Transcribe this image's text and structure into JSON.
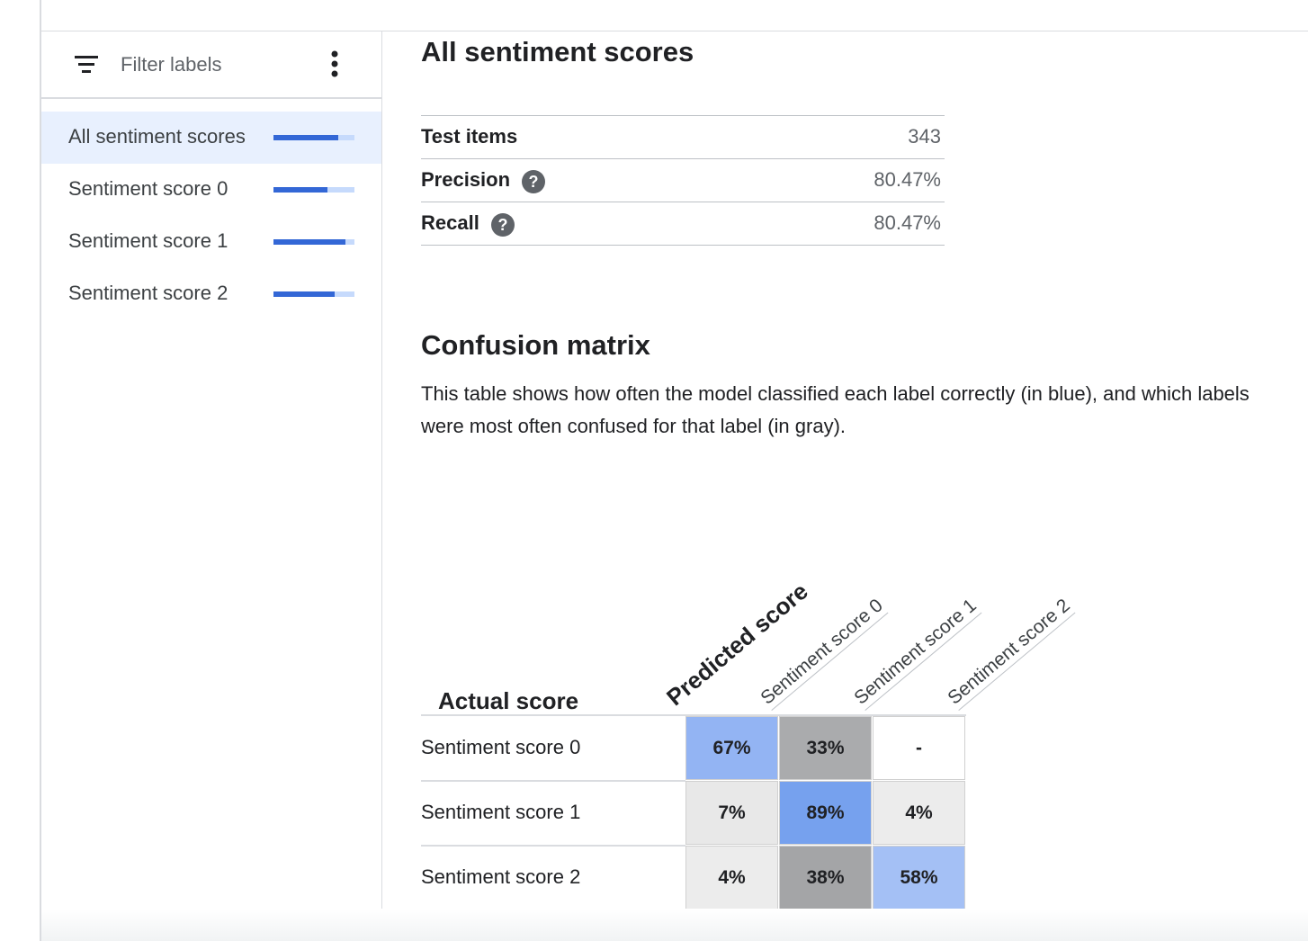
{
  "sidebar": {
    "filter_placeholder": "Filter labels",
    "filter_icon": "filter-list-icon",
    "more_icon": "more-vert-icon",
    "items": [
      {
        "label": "All sentiment scores",
        "score": 0.8047,
        "selected": true
      },
      {
        "label": "Sentiment score 0",
        "score": 0.67,
        "selected": false
      },
      {
        "label": "Sentiment score 1",
        "score": 0.89,
        "selected": false
      },
      {
        "label": "Sentiment score 2",
        "score": 0.75,
        "selected": false
      }
    ],
    "bar_fill_color": "#3367d6",
    "bar_track_color": "#c6dafc"
  },
  "main": {
    "title": "All sentiment scores",
    "stats": [
      {
        "label": "Test items",
        "value": "343",
        "help": false
      },
      {
        "label": "Precision",
        "value": "80.47%",
        "help": true
      },
      {
        "label": "Recall",
        "value": "80.47%",
        "help": true
      }
    ],
    "help_glyph": "?",
    "confusion": {
      "title": "Confusion matrix",
      "description": "This table shows how often the model classified each label correctly (in blue), and which labels were most often confused for that label (in gray).",
      "actual_label": "Actual score",
      "predicted_label": "Predicted score",
      "columns": [
        "Sentiment score 0",
        "Sentiment score 1",
        "Sentiment score 2"
      ],
      "rows": [
        {
          "label": "Sentiment score 0",
          "cells": [
            {
              "text": "67%",
              "color": "#93b4f3"
            },
            {
              "text": "33%",
              "color": "#aaabad"
            },
            {
              "text": "-",
              "color": "#ffffff"
            }
          ]
        },
        {
          "label": "Sentiment score 1",
          "cells": [
            {
              "text": "7%",
              "color": "#e8e8e8"
            },
            {
              "text": "89%",
              "color": "#76a1ee"
            },
            {
              "text": "4%",
              "color": "#ececec"
            }
          ]
        },
        {
          "label": "Sentiment score 2",
          "cells": [
            {
              "text": "4%",
              "color": "#ececec"
            },
            {
              "text": "38%",
              "color": "#a4a5a7"
            },
            {
              "text": "58%",
              "color": "#a4c0f5"
            }
          ]
        }
      ]
    }
  }
}
